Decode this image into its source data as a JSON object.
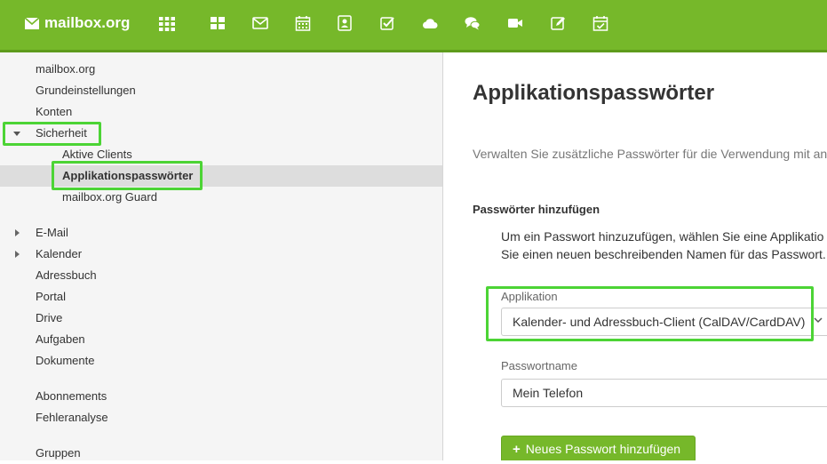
{
  "brand": {
    "name": "mailbox.org",
    "icon": "envelope-icon"
  },
  "topbar": {
    "apps_icon": "apps-grid-icon",
    "apps": [
      {
        "name": "portal",
        "icon": "dashboard-icon"
      },
      {
        "name": "mail",
        "icon": "mail-icon"
      },
      {
        "name": "calendar",
        "icon": "calendar-icon"
      },
      {
        "name": "addressbook",
        "icon": "contacts-icon"
      },
      {
        "name": "tasks",
        "icon": "tasks-icon"
      },
      {
        "name": "drive",
        "icon": "cloud-icon"
      },
      {
        "name": "chat",
        "icon": "chat-icon"
      },
      {
        "name": "video",
        "icon": "video-icon"
      },
      {
        "name": "documents",
        "icon": "edit-icon"
      },
      {
        "name": "planner",
        "icon": "calendar-check-icon"
      }
    ]
  },
  "sidebar": {
    "items": [
      {
        "label": "mailbox.org"
      },
      {
        "label": "Grundeinstellungen"
      },
      {
        "label": "Konten"
      },
      {
        "label": "Sicherheit",
        "expanded": true
      },
      {
        "label": "Aktive Clients"
      },
      {
        "label": "Applikationspasswörter",
        "selected": true
      },
      {
        "label": "mailbox.org Guard"
      },
      {
        "label": "E-Mail",
        "expandable": true
      },
      {
        "label": "Kalender",
        "expandable": true
      },
      {
        "label": "Adressbuch"
      },
      {
        "label": "Portal"
      },
      {
        "label": "Drive"
      },
      {
        "label": "Aufgaben"
      },
      {
        "label": "Dokumente"
      },
      {
        "label": "Abonnements"
      },
      {
        "label": "Fehleranalyse"
      },
      {
        "label": "Gruppen"
      }
    ]
  },
  "main": {
    "title": "Applikationspasswörter",
    "description": "Verwalten Sie zusätzliche Passwörter für die Verwendung mit an",
    "section_title": "Passwörter hinzufügen",
    "help_line1": "Um ein Passwort hinzuzufügen, wählen Sie eine Applikatio",
    "help_line2": "Sie einen neuen beschreibenden Namen für das Passwort.",
    "application_label": "Applikation",
    "application_value": "Kalender- und Adressbuch-Client (CalDAV/CardDAV)",
    "password_name_label": "Passwortname",
    "password_name_value": "Mein Telefon",
    "add_button_label": "Neues Passwort hinzufügen"
  },
  "colors": {
    "brand_green": "#76b82a",
    "highlight_green": "#4cd435"
  }
}
